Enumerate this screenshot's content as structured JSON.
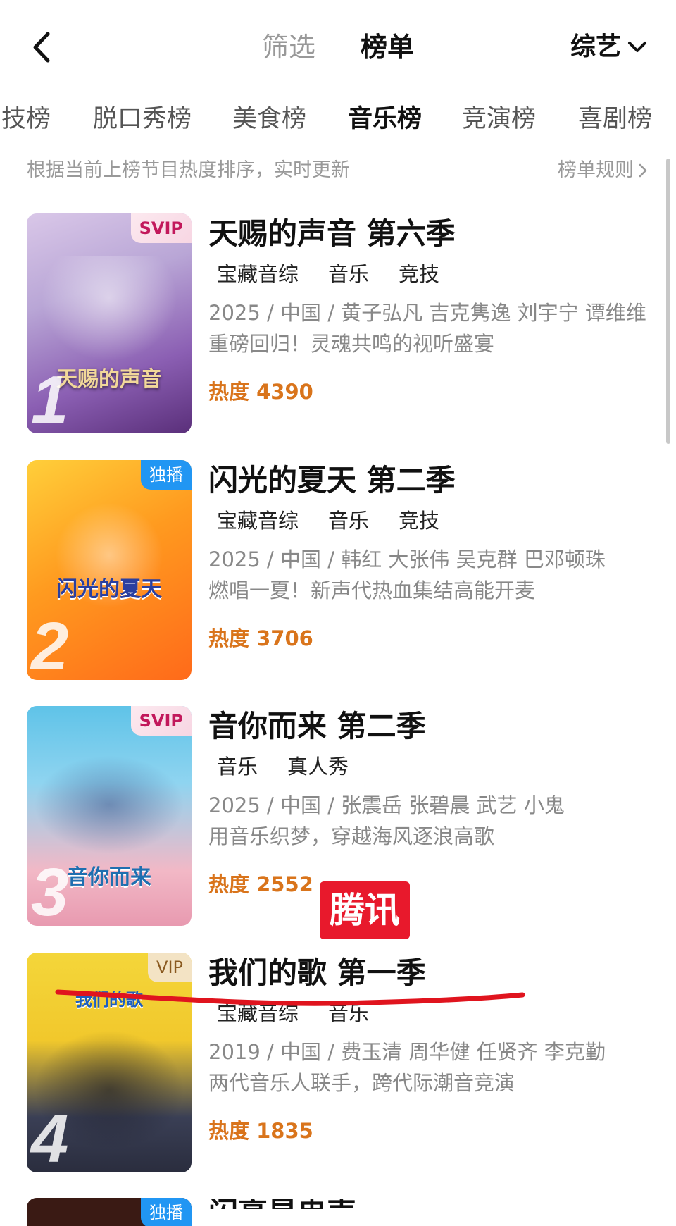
{
  "header": {
    "tab_filter": "筛选",
    "tab_chart": "榜单",
    "category": "综艺"
  },
  "subtabs": [
    "技榜",
    "脱口秀榜",
    "美食榜",
    "音乐榜",
    "竞演榜",
    "喜剧榜"
  ],
  "active_subtab": "音乐榜",
  "info": {
    "text": "根据当前上榜节目热度排序，实时更新",
    "rules": "榜单规则"
  },
  "items": [
    {
      "rank": "1",
      "badge": "SVIP",
      "poster_caption": "天赐的声音",
      "title": "天赐的声音 第六季",
      "tags": [
        "宝藏音综",
        "音乐",
        "竞技"
      ],
      "meta": "2025 / 中国 / 黄子弘凡 吉克隽逸 刘宇宁 谭维维",
      "desc": "重磅回归！灵魂共鸣的视听盛宴",
      "heat": "热度 4390"
    },
    {
      "rank": "2",
      "badge": "独播",
      "poster_caption": "闪光的夏天",
      "title": "闪光的夏天 第二季",
      "tags": [
        "宝藏音综",
        "音乐",
        "竞技"
      ],
      "meta": "2025 / 中国 / 韩红 大张伟 吴克群 巴邓顿珠",
      "desc": "燃唱一夏！新声代热血集结高能开麦",
      "heat": "热度 3706"
    },
    {
      "rank": "3",
      "badge": "SVIP",
      "poster_caption": "音你而来",
      "title": "音你而来 第二季",
      "tags": [
        "音乐",
        "真人秀"
      ],
      "meta": "2025 / 中国 / 张震岳 张碧晨 武艺 小鬼",
      "desc": "用音乐织梦，穿越海风逐浪高歌",
      "heat": "热度 2552"
    },
    {
      "rank": "4",
      "badge": "VIP",
      "poster_caption": "我们的歌",
      "title": "我们的歌 第一季",
      "tags": [
        "宝藏音综",
        "音乐"
      ],
      "meta": "2019 / 中国 / 费玉清 周华健 任贤齐 李克勤",
      "desc": "两代音乐人联手，跨代际潮音竞演",
      "heat": "热度 1835"
    }
  ],
  "item5": {
    "badge": "独播",
    "title": "闪亮星冉声"
  },
  "stamp": "腾讯",
  "colors": {
    "heat": "#d9741b",
    "stamp": "#e8192c",
    "underline": "#e0141e",
    "exclusive_badge": "#2196f3"
  }
}
